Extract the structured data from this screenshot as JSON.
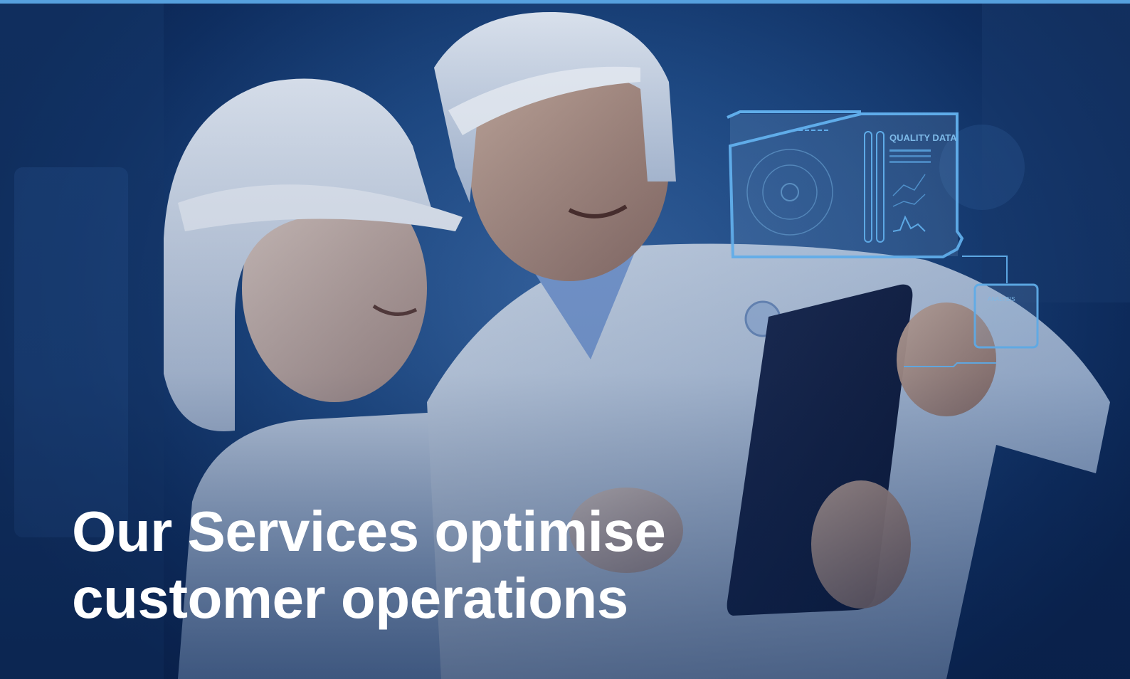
{
  "hero": {
    "headline_line1": "Our Services optimise",
    "headline_line2": "customer operations",
    "hud_panel_title": "QUALITY DATA",
    "hud_small_label": "ANALYSIS"
  },
  "colors": {
    "accent_bar": "#5aa7e6",
    "background": "#1f4b86",
    "hud_line": "#6cc0ff",
    "headline_text": "#ffffff"
  }
}
